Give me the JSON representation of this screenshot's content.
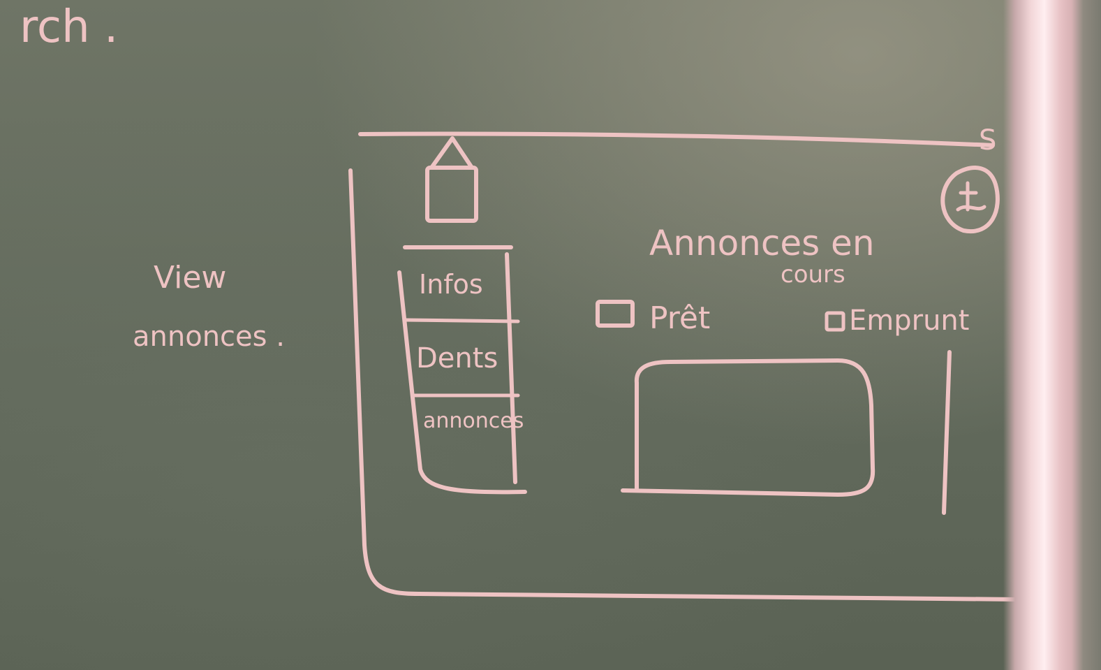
{
  "top_left_text": "rch .",
  "left_label": {
    "line1": "View",
    "line2": "annonces ."
  },
  "sidebar": {
    "items": [
      "Infos",
      "Dents",
      "annonces"
    ]
  },
  "main": {
    "title_line1": "Annonces en",
    "title_line2": "cours",
    "checkboxes": [
      {
        "label": "Prêt"
      },
      {
        "label": "Emprunt"
      }
    ]
  },
  "corner_mark": "S",
  "profile_icon": "user-avatar-icon",
  "home_icon": "house-icon",
  "colors": {
    "board": "#626a5c",
    "chalk": "#eec3c3"
  }
}
